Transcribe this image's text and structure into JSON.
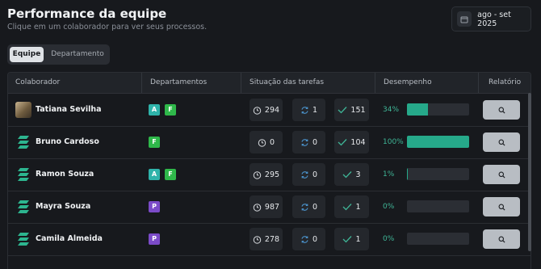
{
  "header": {
    "title": "Performance da equipe",
    "subtitle": "Clique em um colaborador para ver seus processos.",
    "date_range": "ago - set 2025"
  },
  "tabs": [
    {
      "label": "Equipe",
      "active": true
    },
    {
      "label": "Departamento",
      "active": false
    }
  ],
  "table": {
    "columns": [
      "Colaborador",
      "Departamentos",
      "Situação das tarefas",
      "Desempenho",
      "Relatório"
    ],
    "rows": [
      {
        "name": "Tatiana Sevilha",
        "avatar": "photo",
        "departments": [
          "A",
          "F"
        ],
        "pending": "294",
        "in_progress": "1",
        "done": "151",
        "performance_label": "34%",
        "performance": 0.34
      },
      {
        "name": "Bruno Cardoso",
        "avatar": "logo",
        "departments": [
          "F"
        ],
        "pending": "0",
        "in_progress": "0",
        "done": "104",
        "performance_label": "100%",
        "performance": 1.0
      },
      {
        "name": "Ramon Souza",
        "avatar": "logo",
        "departments": [
          "A",
          "F"
        ],
        "pending": "295",
        "in_progress": "0",
        "done": "3",
        "performance_label": "1%",
        "performance": 0.01
      },
      {
        "name": "Mayra Souza",
        "avatar": "logo",
        "departments": [
          "P"
        ],
        "pending": "987",
        "in_progress": "0",
        "done": "1",
        "performance_label": "0%",
        "performance": 0.0
      },
      {
        "name": "Camila Almeida",
        "avatar": "logo",
        "departments": [
          "P"
        ],
        "pending": "278",
        "in_progress": "0",
        "done": "1",
        "performance_label": "0%",
        "performance": 0.0
      }
    ]
  },
  "colors": {
    "dept_A": "#2fb3aa",
    "dept_F": "#2fb84a",
    "dept_P": "#7b4bc8",
    "accent": "#26a98a",
    "logo": "#2db58f"
  },
  "icons": {
    "pending": "hourglass-icon",
    "in_progress": "refresh-icon",
    "done": "check-icon",
    "report": "search-icon",
    "date": "calendar-icon"
  }
}
